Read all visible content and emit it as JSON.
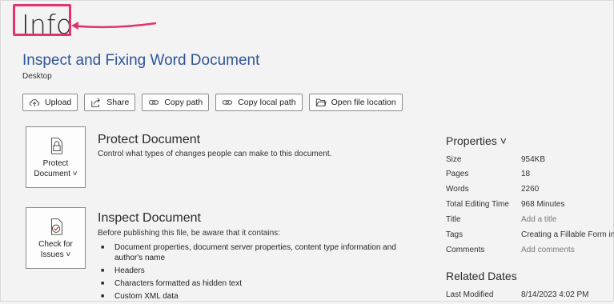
{
  "page": {
    "title": "Info"
  },
  "document": {
    "title": "Inspect and Fixing Word Document",
    "location": "Desktop"
  },
  "actions": [
    {
      "label": "Upload",
      "icon": "upload-icon"
    },
    {
      "label": "Share",
      "icon": "share-icon"
    },
    {
      "label": "Copy path",
      "icon": "link-icon"
    },
    {
      "label": "Copy local path",
      "icon": "link-icon"
    },
    {
      "label": "Open file location",
      "icon": "folder-icon"
    }
  ],
  "protect": {
    "button_line1": "Protect",
    "button_line2": "Document ˅",
    "title": "Protect Document",
    "description": "Control what types of changes people can make to this document."
  },
  "inspect": {
    "button_line1": "Check for",
    "button_line2": "Issues ˅",
    "title": "Inspect Document",
    "description": "Before publishing this file, be aware that it contains:",
    "items": [
      "Document properties, document server properties, content type information and author's name",
      "Headers",
      "Characters formatted as hidden text",
      "Custom XML data"
    ]
  },
  "properties": {
    "title": "Properties ˅",
    "rows": [
      {
        "key": "Size",
        "value": "954KB"
      },
      {
        "key": "Pages",
        "value": "18"
      },
      {
        "key": "Words",
        "value": "2260"
      },
      {
        "key": "Total Editing Time",
        "value": "968 Minutes"
      },
      {
        "key": "Title",
        "value": "Add a title"
      },
      {
        "key": "Tags",
        "value": "Creating a Fillable Form in..."
      },
      {
        "key": "Comments",
        "value": "Add comments"
      }
    ]
  },
  "related_dates": {
    "title": "Related Dates",
    "rows": [
      {
        "key": "Last Modified",
        "value": "8/14/2023 4:02 PM"
      }
    ]
  },
  "colors": {
    "accent": "#2f5597",
    "highlight": "#e4326e"
  }
}
